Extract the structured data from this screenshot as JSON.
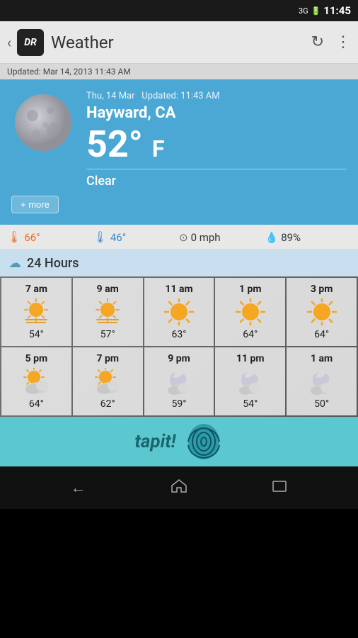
{
  "status_bar": {
    "time": "11:45",
    "network": "3G"
  },
  "app_bar": {
    "back_icon": "‹",
    "logo_text": "DR",
    "title": "Weather",
    "refresh_icon": "↻",
    "more_icon": "⋮"
  },
  "update_bar": {
    "text": "Updated: Mar 14, 2013 11:43 AM"
  },
  "weather": {
    "date": "Thu, 14 Mar",
    "updated_label": "Updated: 11:43 AM",
    "city": "Hayward, CA",
    "temperature": "52°",
    "unit": "F",
    "condition": "Clear",
    "more_button": "+ more"
  },
  "stats": {
    "high_value": "66°",
    "low_value": "46°",
    "wind": "0 mph",
    "humidity": "89%"
  },
  "hours_header": {
    "text": "24 Hours"
  },
  "hourly": [
    {
      "time": "7 am",
      "temp": "54°",
      "icon_type": "haze-sun"
    },
    {
      "time": "9 am",
      "temp": "57°",
      "icon_type": "haze-sun"
    },
    {
      "time": "11 am",
      "temp": "63°",
      "icon_type": "sun"
    },
    {
      "time": "1 pm",
      "temp": "64°",
      "icon_type": "sun"
    },
    {
      "time": "3 pm",
      "temp": "64°",
      "icon_type": "sun"
    },
    {
      "time": "5 pm",
      "temp": "64°",
      "icon_type": "partly-cloudy"
    },
    {
      "time": "7 pm",
      "temp": "62°",
      "icon_type": "partly-cloudy"
    },
    {
      "time": "9 pm",
      "temp": "59°",
      "icon_type": "moon-cloud"
    },
    {
      "time": "11 pm",
      "temp": "54°",
      "icon_type": "moon-cloud"
    },
    {
      "time": "1 am",
      "temp": "50°",
      "icon_type": "moon-cloud"
    }
  ],
  "ad": {
    "text": "tapit!",
    "icon": "fingerprint"
  },
  "nav": {
    "back": "←",
    "home": "⌂",
    "recents": "▭"
  }
}
